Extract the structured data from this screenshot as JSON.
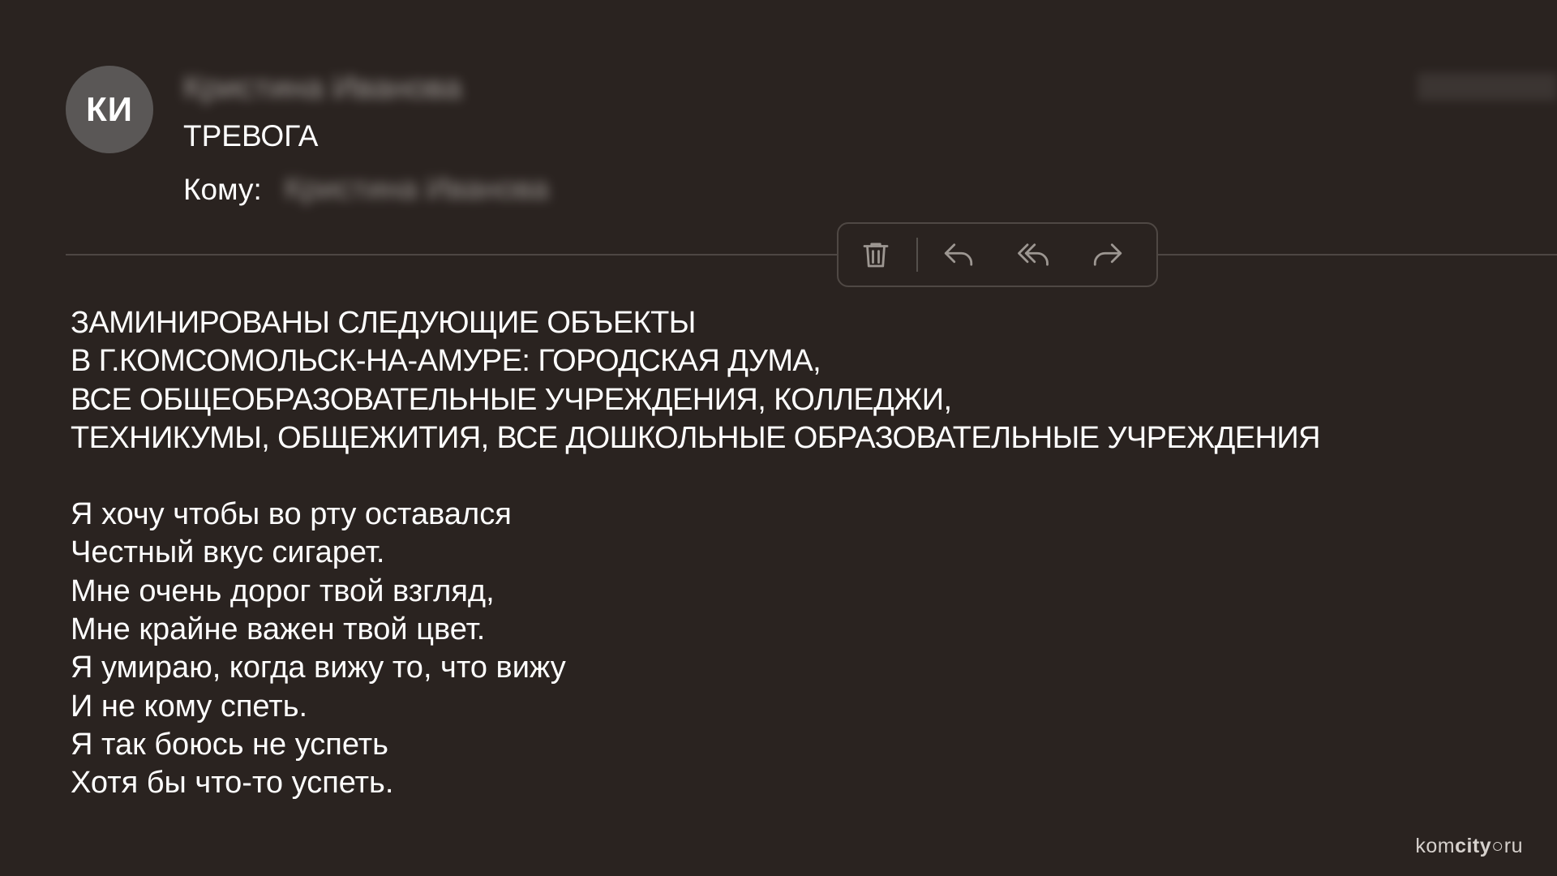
{
  "avatar": {
    "initials": "КИ"
  },
  "header": {
    "sender_name": "Кристина Иванова",
    "subject": "ТРЕВОГА",
    "to_label": "Кому:",
    "to_value": "Кристина Иванова"
  },
  "toolbar": {
    "icons": [
      "trash-icon",
      "reply-icon",
      "reply-all-icon",
      "forward-icon"
    ]
  },
  "body": {
    "caps_lines": [
      "ЗАМИНИРОВАНЫ СЛЕДУЮЩИЕ ОБЪЕКТЫ",
      "В Г.КОМСОМОЛЬСК-НА-АМУРЕ: ГОРОДСКАЯ ДУМА,",
      "ВСЕ ОБЩЕОБРАЗОВАТЕЛЬНЫЕ УЧРЕЖДЕНИЯ, КОЛЛЕДЖИ,",
      "ТЕХНИКУМЫ, ОБЩЕЖИТИЯ, ВСЕ ДОШКОЛЬНЫЕ ОБРАЗОВАТЕЛЬНЫЕ УЧРЕЖДЕНИЯ"
    ],
    "verse_lines": [
      "Я хочу чтобы во рту оставался",
      "Честный вкус сигарет.",
      "Мне очень дорог твой взгляд,",
      "Мне крайне важен твой цвет.",
      "Я умираю, когда вижу то, что вижу",
      "И не кому спеть.",
      "Я так боюсь не успеть",
      "Хотя бы что-то успеть."
    ]
  },
  "watermark": {
    "part1": "kom",
    "part2": "city",
    "part3": "ru"
  },
  "colors": {
    "background": "#2a2320",
    "avatar": "#5a5756",
    "divider": "#4d4643",
    "icon": "#9d9792"
  }
}
